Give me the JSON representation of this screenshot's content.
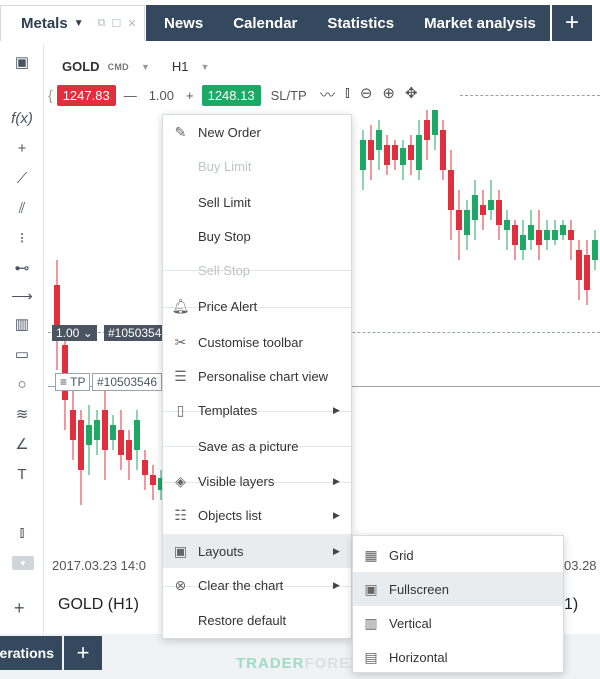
{
  "header": {
    "workspace_label": "Metals",
    "nav": [
      "News",
      "Calendar",
      "Statistics",
      "Market analysis"
    ],
    "add_tab": "+"
  },
  "instrument": {
    "symbol": "GOLD",
    "type": "CMD",
    "timeframe": "H1"
  },
  "trade": {
    "sell_price": "1247.83",
    "minus": "—",
    "quantity": "1.00",
    "plus": "+",
    "buy_price": "1248.13",
    "sltp": "SL/TP"
  },
  "chart": {
    "order_volume": "1.00",
    "order_id": "#1050354",
    "tp_label": "TP",
    "tp_id": "#10503546",
    "date_left": "2017.03.23 14:0",
    "date_right": "03.28",
    "title": "GOLD (H1)",
    "title_right": "1)",
    "colors": {
      "up": "#1ea865",
      "down": "#e1303d"
    }
  },
  "menu": {
    "items": [
      {
        "label": "New Order",
        "icon": "edit-icon",
        "disabled": false,
        "submenu": false
      },
      {
        "label": "Buy Limit",
        "icon": "",
        "disabled": true,
        "submenu": false
      },
      {
        "label": "Sell Limit",
        "icon": "",
        "disabled": false,
        "submenu": false
      },
      {
        "label": "Buy Stop",
        "icon": "",
        "disabled": false,
        "submenu": false
      },
      {
        "label": "Sell Stop",
        "icon": "",
        "disabled": true,
        "submenu": false
      },
      {
        "label": "Price Alert",
        "icon": "bell-icon",
        "disabled": false,
        "submenu": false
      },
      {
        "label": "Customise toolbar",
        "icon": "tools-icon",
        "disabled": false,
        "submenu": false
      },
      {
        "label": "Personalise chart view",
        "icon": "sliders-icon",
        "disabled": false,
        "submenu": false
      },
      {
        "label": "Templates",
        "icon": "document-icon",
        "disabled": false,
        "submenu": true
      },
      {
        "label": "Save as a picture",
        "icon": "",
        "disabled": false,
        "submenu": false
      },
      {
        "label": "Visible layers",
        "icon": "layers-icon",
        "disabled": false,
        "submenu": true
      },
      {
        "label": "Objects list",
        "icon": "list-icon",
        "disabled": false,
        "submenu": true
      },
      {
        "label": "Layouts",
        "icon": "layout-icon",
        "disabled": false,
        "submenu": true,
        "active": true
      },
      {
        "label": "Clear the chart",
        "icon": "clear-icon",
        "disabled": false,
        "submenu": true
      },
      {
        "label": "Restore default",
        "icon": "",
        "disabled": false,
        "submenu": false
      }
    ]
  },
  "layouts_submenu": {
    "items": [
      {
        "label": "Grid",
        "icon": "grid-icon"
      },
      {
        "label": "Fullscreen",
        "icon": "fullscreen-icon",
        "active": true
      },
      {
        "label": "Vertical",
        "icon": "vertical-icon"
      },
      {
        "label": "Horizontal",
        "icon": "horizontal-icon"
      }
    ]
  },
  "bottom": {
    "tab_label": "erations",
    "add": "+"
  },
  "watermark": {
    "a": "TRADER",
    "b": "FOREX"
  }
}
